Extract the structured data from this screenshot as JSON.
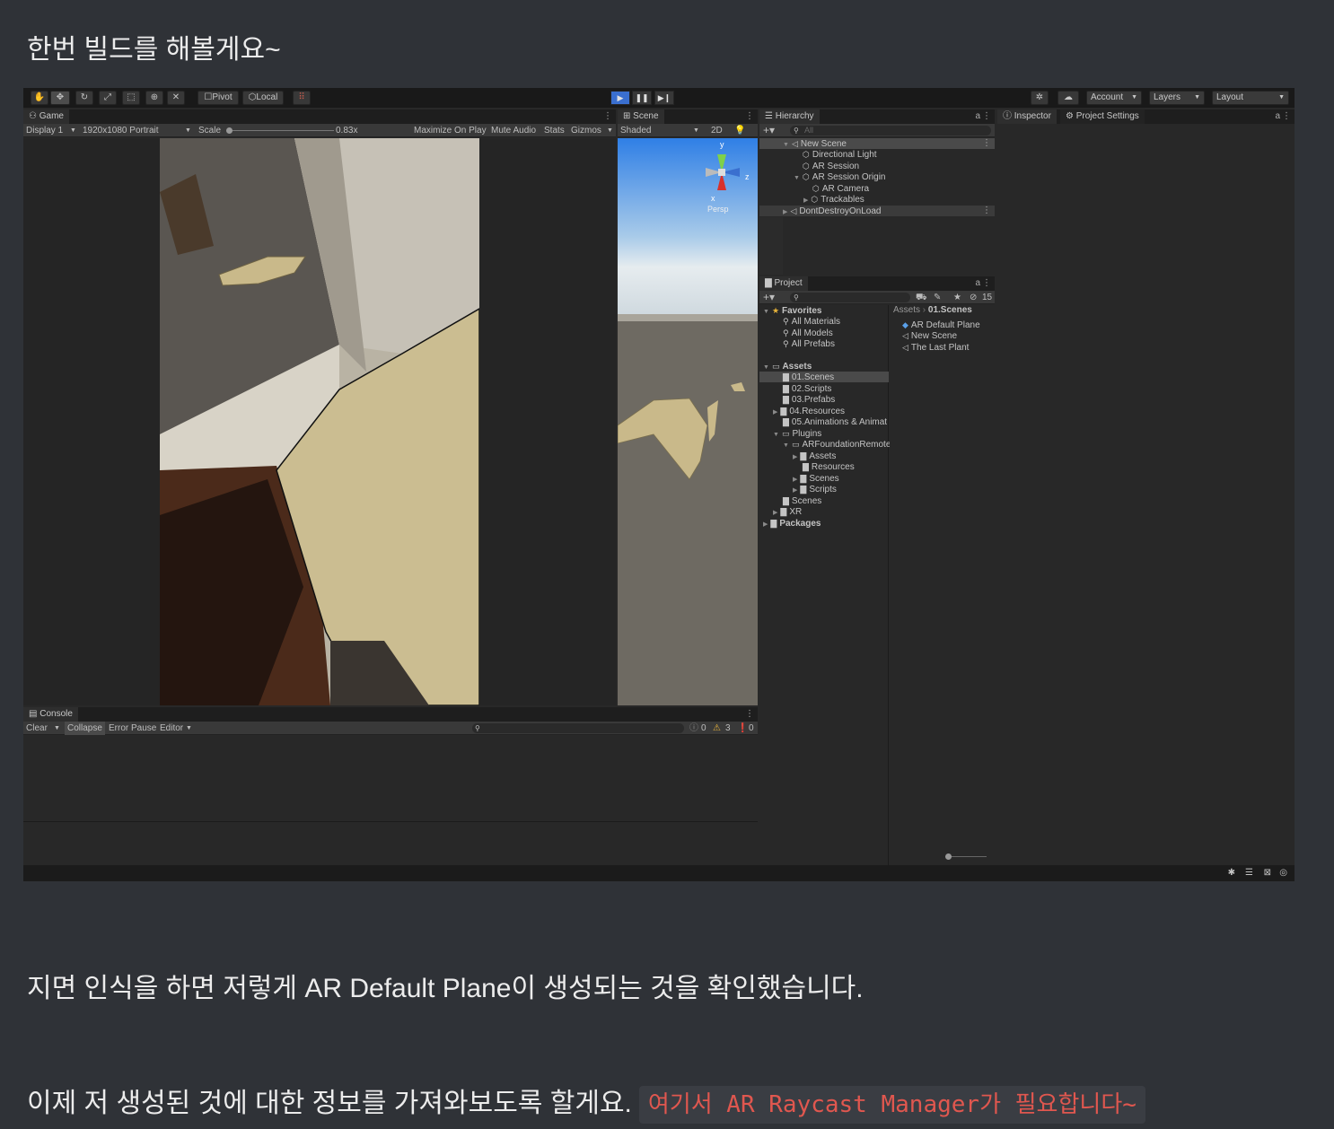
{
  "paragraphs": {
    "p1": "한번 빌드를 해볼게요~",
    "p2": "지면 인식을 하면 저렇게 AR Default Plane이 생성되는 것을 확인했습니다.",
    "p3_text": "이제 저 생성된 것에 대한 정보를 가져와보도록 할게요.",
    "p3_code": "여기서 AR Raycast Manager가 필요합니다~"
  },
  "toolbar": {
    "tools": [
      "hand-tool",
      "move-tool",
      "rotate-tool",
      "scale-tool",
      "rect-tool",
      "transform-tool",
      "custom-tool"
    ],
    "pivot_label": "Pivot",
    "local_label": "Local",
    "account_label": "Account",
    "layers_label": "Layers",
    "layout_label": "Layout"
  },
  "game_view": {
    "tab_label": "Game",
    "display_label": "Display 1",
    "resolution_label": "1920x1080 Portrait",
    "scale_label": "Scale",
    "scale_value": "0.83x",
    "maximize_label": "Maximize On Play",
    "mute_label": "Mute Audio",
    "stats_label": "Stats",
    "gizmos_label": "Gizmos"
  },
  "scene_view": {
    "tab_label": "Scene",
    "shading_label": "Shaded",
    "mode_2d": "2D",
    "persp_label": "Persp",
    "axis_y": "y",
    "axis_z": "z",
    "axis_x": "x"
  },
  "hierarchy": {
    "tab_label": "Hierarchy",
    "search_placeholder": "All",
    "items": [
      {
        "label": "New Scene"
      },
      {
        "label": "Directional Light"
      },
      {
        "label": "AR Session"
      },
      {
        "label": "AR Session Origin"
      },
      {
        "label": "AR Camera"
      },
      {
        "label": "Trackables"
      },
      {
        "label": "DontDestroyOnLoad"
      }
    ]
  },
  "inspector": {
    "tab_label": "Inspector",
    "project_settings_label": "Project Settings"
  },
  "project": {
    "tab_label": "Project",
    "hidden_count": "15",
    "breadcrumb_root": "Assets",
    "breadcrumb_current": "01.Scenes",
    "tree": [
      {
        "label": "Favorites"
      },
      {
        "label": "All Materials"
      },
      {
        "label": "All Models"
      },
      {
        "label": "All Prefabs"
      },
      {
        "label": "Assets"
      },
      {
        "label": "01.Scenes"
      },
      {
        "label": "02.Scripts"
      },
      {
        "label": "03.Prefabs"
      },
      {
        "label": "04.Resources"
      },
      {
        "label": "05.Animations & Animat"
      },
      {
        "label": "Plugins"
      },
      {
        "label": "ARFoundationRemote"
      },
      {
        "label": "Assets"
      },
      {
        "label": "Resources"
      },
      {
        "label": "Scenes"
      },
      {
        "label": "Scripts"
      },
      {
        "label": "Scenes"
      },
      {
        "label": "XR"
      },
      {
        "label": "Packages"
      }
    ],
    "files": [
      {
        "label": "AR Default Plane"
      },
      {
        "label": "New Scene"
      },
      {
        "label": "The Last Plant"
      }
    ]
  },
  "console": {
    "tab_label": "Console",
    "clear_label": "Clear",
    "collapse_label": "Collapse",
    "error_pause_label": "Error Pause",
    "editor_label": "Editor",
    "info_count": "0",
    "warn_count": "3",
    "error_count": "0"
  },
  "colors": {
    "page_bg": "#2f3237",
    "code_text": "#e0574f",
    "code_bg": "#3a3d43",
    "unity_accent": "#3a6fcf",
    "plane_fill": "#c9b98a"
  }
}
